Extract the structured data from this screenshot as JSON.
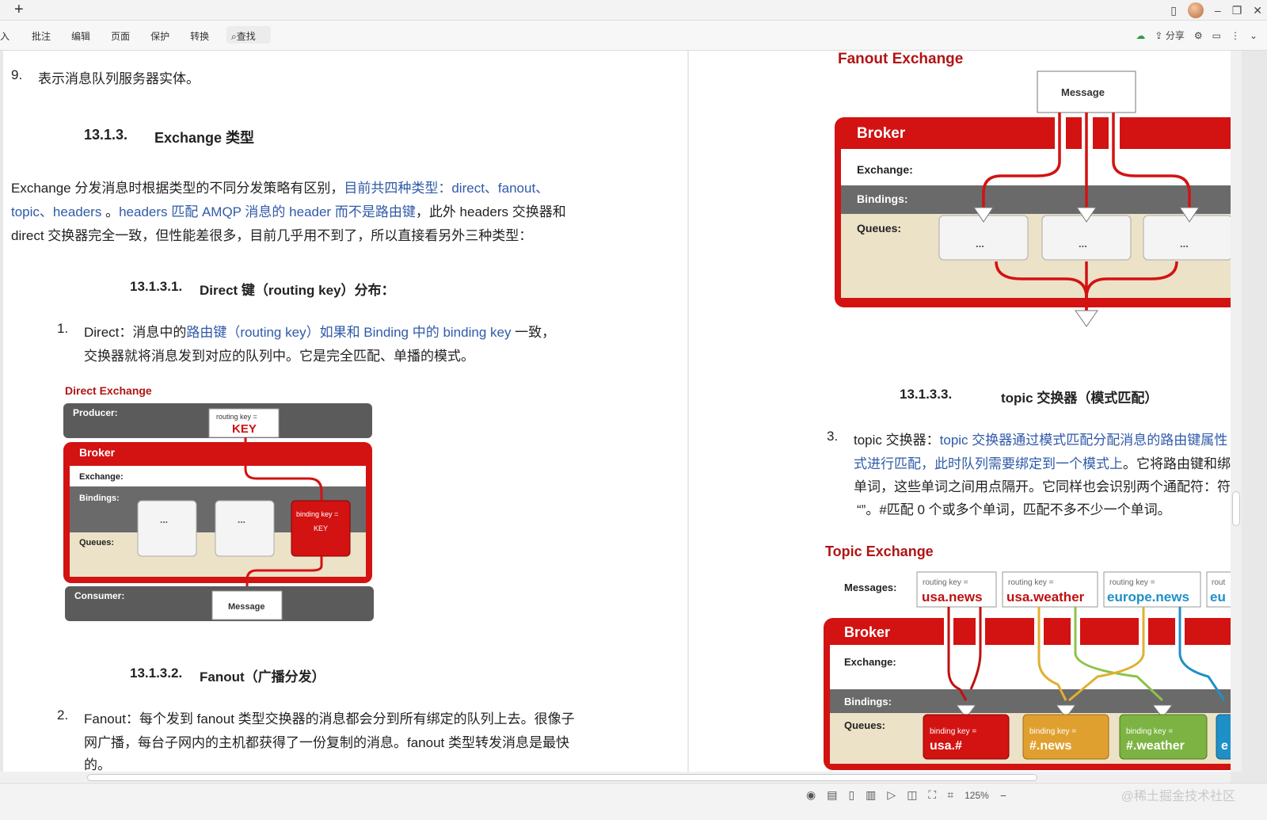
{
  "titlebar": {
    "new_tab": "+",
    "minimize": "–",
    "restore": "❐",
    "close": "✕"
  },
  "menu": {
    "items": [
      "入",
      "批注",
      "编辑",
      "页面",
      "保护",
      "转换"
    ],
    "search": "查找"
  },
  "toolbar_right": {
    "share": "分享"
  },
  "doc_left": {
    "item9_num": "9.",
    "item9_text": "表示消息队列服务器实体。",
    "h_1313": "13.1.3.",
    "h_1313_title": "Exchange 类型",
    "p1_a": "Exchange 分发消息时根据类型的不同分发策略有区别，",
    "p1_b": "目前共四种类型：direct、fanout、",
    "p2_a": "topic、headers",
    "p2_b": " 。",
    "p2_c": "headers 匹配 AMQP 消息的 header 而不是路由键",
    "p2_d": "，此外 headers 交换器和",
    "p3": "direct 交换器完全一致，但性能差很多，目前几乎用不到了，所以直接看另外三种类型：",
    "h_13131": "13.1.3.1.",
    "h_13131_title": "Direct 键（routing key）分布：",
    "item1_num": "1.",
    "item1_a": "Direct：消息中的",
    "item1_b": "路由键（routing key）如果和 Binding 中的 binding key",
    "item1_c": " 一致，",
    "item1_line2": "交换器就将消息发到对应的队列中。它是完全匹配、单播的模式。",
    "direct_fig": {
      "title": "Direct Exchange",
      "producer": "Producer:",
      "routing_key": "routing key =",
      "key": "KEY",
      "broker": "Broker",
      "exchange": "Exchange:",
      "bindings": "Bindings:",
      "queues": "Queues:",
      "dots": "...",
      "binding_key": "binding key =",
      "binding_val": "KEY",
      "consumer": "Consumer:",
      "message": "Message"
    },
    "h_13132": "13.1.3.2.",
    "h_13132_title": "Fanout（广播分发）",
    "item2_num": "2.",
    "item2_line1": "Fanout：每个发到 fanout 类型交换器的消息都会分到所有绑定的队列上去。很像子",
    "item2_line2": "网广播，每台子网内的主机都获得了一份复制的消息。fanout 类型转发消息是最快",
    "item2_line3": "的。"
  },
  "doc_right": {
    "fanout_fig": {
      "title": "Fanout Exchange",
      "message": "Message",
      "broker": "Broker",
      "exchange": "Exchange:",
      "bindings": "Bindings:",
      "queues": "Queues:",
      "dots": "..."
    },
    "h_13133": "13.1.3.3.",
    "h_13133_title": "topic 交换器（模式匹配）",
    "item3_num": "3.",
    "item3_a": "topic 交换器：",
    "item3_b": "topic 交换器通过模式匹配分配消息的路由键属性",
    "item3_line2_a": "式进行匹配，此时队列需要绑定到一个模式上",
    "item3_line2_b": "。它将路由键和绑",
    "item3_line3": "单词，这些单词之间用点隔开。它同样也会识别两个通配符：符",
    "item3_line4": "“”。#匹配 0 个或多个单词，匹配不多不少一个单词。",
    "topic_fig": {
      "title": "Topic Exchange",
      "messages": "Messages:",
      "routing_key": "routing key =",
      "rk1": "usa.news",
      "rk2": "usa.weather",
      "rk3": "europe.news",
      "rk4": "eu",
      "rk4_label": "rout",
      "broker": "Broker",
      "exchange": "Exchange:",
      "bindings": "Bindings:",
      "queues": "Queues:",
      "binding_key": "binding key =",
      "bk1": "usa.#",
      "bk2": "#.news",
      "bk3": "#.weather",
      "bk4": "e"
    }
  },
  "statusbar": {
    "zoom": "125%",
    "watermark": "@稀土掘金技术社区"
  }
}
